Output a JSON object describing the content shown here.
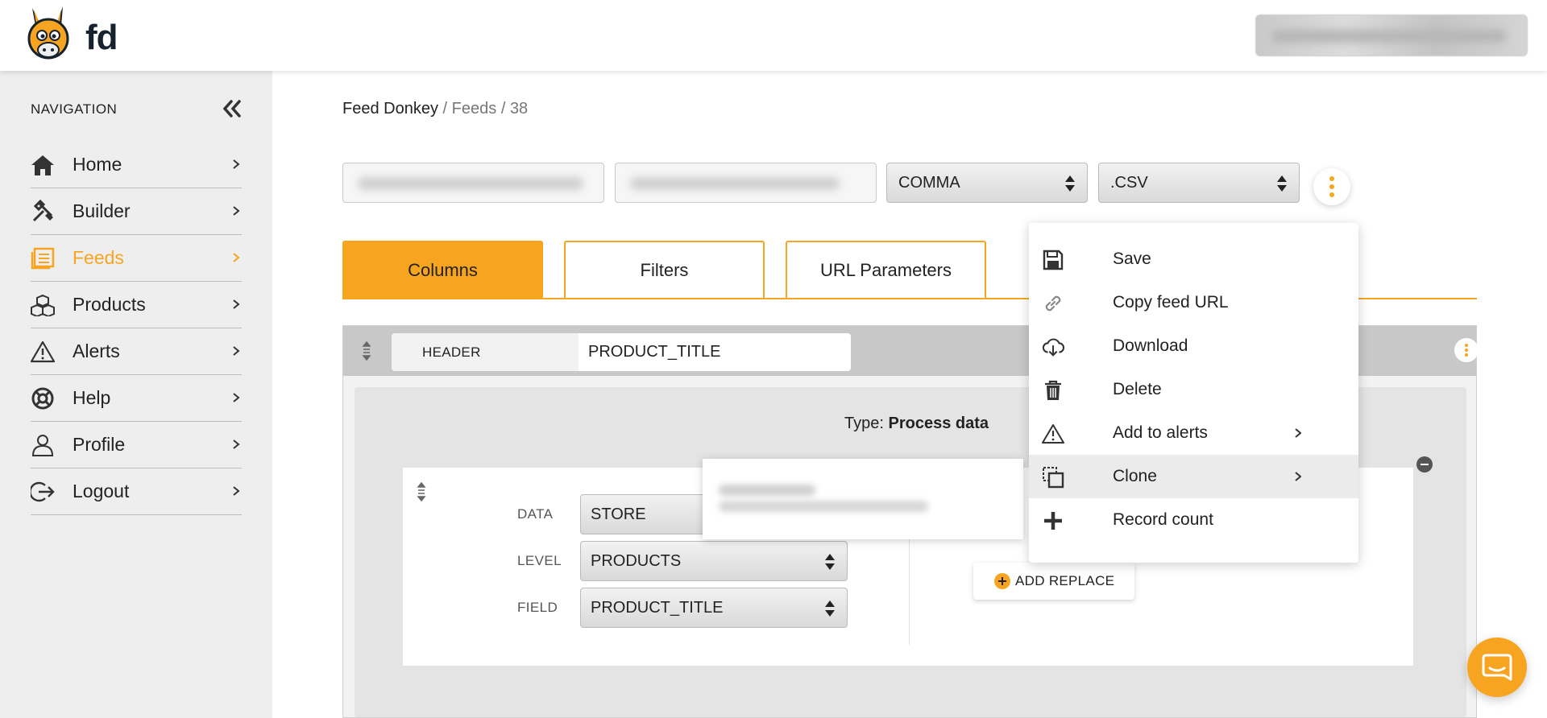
{
  "app": {
    "logo_text": "fd"
  },
  "header": {
    "user_menu": ""
  },
  "sidebar": {
    "title": "NAVIGATION",
    "items": [
      {
        "label": "Home",
        "icon": "home-icon"
      },
      {
        "label": "Builder",
        "icon": "tools-icon"
      },
      {
        "label": "Feeds",
        "icon": "feeds-icon",
        "active": true
      },
      {
        "label": "Products",
        "icon": "boxes-icon"
      },
      {
        "label": "Alerts",
        "icon": "warning-icon"
      },
      {
        "label": "Help",
        "icon": "lifebuoy-icon"
      },
      {
        "label": "Profile",
        "icon": "user-icon"
      },
      {
        "label": "Logout",
        "icon": "logout-icon"
      }
    ]
  },
  "breadcrumb": {
    "root": "Feed Donkey",
    "sep": "/",
    "section": "Feeds",
    "id": "38"
  },
  "toolbar": {
    "delimiter": "COMMA",
    "format": ".CSV"
  },
  "tabs": [
    {
      "label": "Columns",
      "active": true
    },
    {
      "label": "Filters"
    },
    {
      "label": "URL Parameters"
    }
  ],
  "column": {
    "header_label": "HEADER",
    "header_value": "PRODUCT_TITLE",
    "type_prefix": "Type:",
    "type_value": "Process data",
    "fields": [
      {
        "label": "DATA",
        "value": "STORE"
      },
      {
        "label": "LEVEL",
        "value": "PRODUCTS"
      },
      {
        "label": "FIELD",
        "value": "PRODUCT_TITLE"
      }
    ],
    "add_replace_label": "ADD REPLACE"
  },
  "menu": {
    "items": [
      {
        "label": "Save",
        "icon": "floppy-icon"
      },
      {
        "label": "Copy feed URL",
        "icon": "link-icon"
      },
      {
        "label": "Download",
        "icon": "cloud-download-icon"
      },
      {
        "label": "Delete",
        "icon": "trash-icon"
      },
      {
        "label": "Add to alerts",
        "icon": "warning-icon",
        "submenu": true
      },
      {
        "label": "Clone",
        "icon": "clone-icon",
        "submenu": true,
        "hover": true
      },
      {
        "label": "Record count",
        "icon": "plus-icon"
      }
    ]
  },
  "colors": {
    "accent": "#f7a520",
    "sidebar_bg": "#eeeeee",
    "dark": "#16222e"
  }
}
